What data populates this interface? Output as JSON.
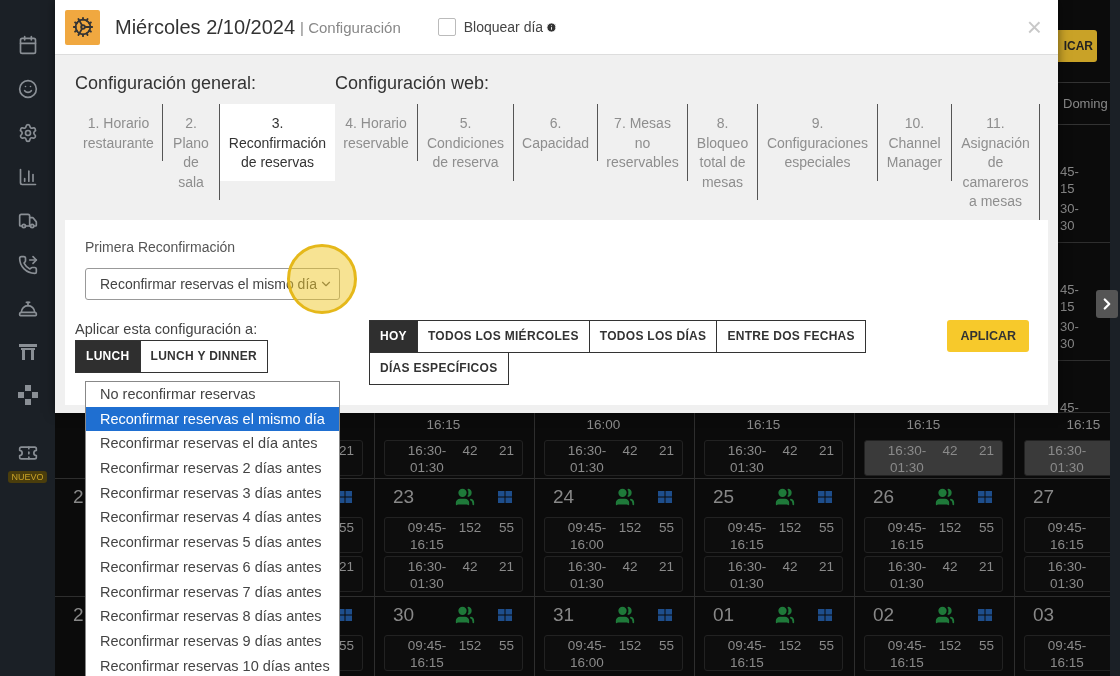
{
  "sidebar": {
    "badge": "NUEVO"
  },
  "topbar": {
    "apply_button": "ICAR",
    "day_header": "Doming"
  },
  "edge_rows": [
    {
      "lines": [
        "45-",
        "15",
        "30-",
        "30"
      ]
    },
    {
      "lines": [
        "45-",
        "15",
        "30-",
        "30"
      ]
    },
    {
      "lines": [
        "45-"
      ]
    }
  ],
  "calendar": {
    "weeks": [
      {
        "kind": "tail",
        "cells": [
          {
            "kind": "left"
          },
          {
            "kind": "right",
            "slots": [
              {
                "tables": "21"
              }
            ]
          },
          {
            "kind": "full",
            "slots": [
              {
                "time": [
                  "16:15"
                ]
              },
              {
                "time": [
                  "16:30-",
                  "01:30"
                ],
                "people": "42",
                "tables": "21",
                "highlighted": false
              }
            ]
          },
          {
            "kind": "full",
            "slots": [
              {
                "time": [
                  "16:00"
                ]
              },
              {
                "time": [
                  "16:30-",
                  "01:30"
                ],
                "people": "42",
                "tables": "21",
                "highlighted": false
              }
            ]
          },
          {
            "kind": "full",
            "slots": [
              {
                "time": [
                  "16:15"
                ]
              },
              {
                "time": [
                  "16:30-",
                  "01:30"
                ],
                "people": "42",
                "tables": "21",
                "highlighted": false
              }
            ]
          },
          {
            "kind": "full",
            "slots": [
              {
                "time": [
                  "16:15"
                ]
              },
              {
                "time": [
                  "16:30-",
                  "01:30"
                ],
                "people": "42",
                "tables": "21",
                "highlighted": true
              }
            ]
          },
          {
            "kind": "cut",
            "slots": [
              {
                "time": [
                  "16:15"
                ]
              },
              {
                "time": [
                  "16:30-",
                  "01:30"
                ],
                "highlighted": true
              }
            ]
          }
        ]
      },
      {
        "kind": "week",
        "cells": [
          {
            "kind": "left",
            "date": "2"
          },
          {
            "kind": "right",
            "slots": [
              {
                "tables": "55"
              },
              {
                "tables": "21"
              }
            ]
          },
          {
            "kind": "full",
            "date": "23",
            "slots": [
              {
                "time": [
                  "09:45-",
                  "16:15"
                ],
                "people": "152",
                "tables": "55",
                "highlighted": false
              },
              {
                "time": [
                  "16:30-",
                  "01:30"
                ],
                "people": "42",
                "tables": "21",
                "highlighted": false
              }
            ]
          },
          {
            "kind": "full",
            "date": "24",
            "slots": [
              {
                "time": [
                  "09:45-",
                  "16:00"
                ],
                "people": "152",
                "tables": "55",
                "highlighted": false
              },
              {
                "time": [
                  "16:30-",
                  "01:30"
                ],
                "people": "42",
                "tables": "21",
                "highlighted": false
              }
            ]
          },
          {
            "kind": "full",
            "date": "25",
            "slots": [
              {
                "time": [
                  "09:45-",
                  "16:15"
                ],
                "people": "152",
                "tables": "55",
                "highlighted": false
              },
              {
                "time": [
                  "16:30-",
                  "01:30"
                ],
                "people": "42",
                "tables": "21",
                "highlighted": false
              }
            ]
          },
          {
            "kind": "full",
            "date": "26",
            "slots": [
              {
                "time": [
                  "09:45-",
                  "16:15"
                ],
                "people": "152",
                "tables": "55",
                "highlighted": false
              },
              {
                "time": [
                  "16:30-",
                  "01:30"
                ],
                "people": "42",
                "tables": "21",
                "highlighted": false
              }
            ]
          },
          {
            "kind": "cut",
            "date": "27",
            "slots": [
              {
                "time": [
                  "09:45-",
                  "16:15"
                ],
                "highlighted": false
              },
              {
                "time": [
                  "16:30-",
                  "01:30"
                ],
                "highlighted": false
              }
            ]
          }
        ]
      },
      {
        "kind": "week",
        "cells": [
          {
            "kind": "left",
            "date": "2"
          },
          {
            "kind": "right",
            "slots": [
              {
                "tables": "55"
              }
            ]
          },
          {
            "kind": "full",
            "date": "30",
            "slots": [
              {
                "time": [
                  "09:45-",
                  "16:15"
                ],
                "people": "152",
                "tables": "55",
                "highlighted": false
              }
            ]
          },
          {
            "kind": "full",
            "date": "31",
            "slots": [
              {
                "time": [
                  "09:45-",
                  "16:00"
                ],
                "people": "152",
                "tables": "55",
                "highlighted": false
              }
            ]
          },
          {
            "kind": "full",
            "date": "01",
            "slots": [
              {
                "time": [
                  "09:45-",
                  "16:15"
                ],
                "people": "152",
                "tables": "55",
                "highlighted": false
              }
            ]
          },
          {
            "kind": "full",
            "date": "02",
            "slots": [
              {
                "time": [
                  "09:45-",
                  "16:15"
                ],
                "people": "152",
                "tables": "55",
                "highlighted": false
              }
            ]
          },
          {
            "kind": "cut",
            "date": "03",
            "slots": [
              {
                "time": [
                  "09:45-",
                  "16:15"
                ],
                "highlighted": false
              }
            ]
          }
        ]
      }
    ]
  },
  "modal": {
    "title": "Miércoles 2/10/2024",
    "subtitle": "| Configuración",
    "block_day": {
      "label": "Bloquear día",
      "checked": false
    },
    "close": "×",
    "groups": [
      {
        "heading": "Configuración general:",
        "tabs": [
          {
            "label": "1. Horario restaurante",
            "selected": false
          },
          {
            "label": "2. Plano de sala",
            "selected": false
          },
          {
            "label": "3. Reconfirmación de reservas",
            "selected": true
          }
        ]
      },
      {
        "heading": "Configuración web:",
        "tabs": [
          {
            "label": "4. Horario reservable",
            "selected": false
          },
          {
            "label": "5. Condiciones de reserva",
            "selected": false
          },
          {
            "label": "6. Capacidad",
            "selected": false
          },
          {
            "label": "7. Mesas no reservables",
            "selected": false
          },
          {
            "label": "8. Bloqueo total de mesas",
            "selected": false
          },
          {
            "label": "9. Configuraciones especiales",
            "selected": false
          },
          {
            "label": "10. Channel Manager",
            "selected": false
          },
          {
            "label": "11. Asignación de camareros a mesas",
            "selected": false
          }
        ]
      }
    ],
    "field_label": "Primera Reconfirmación",
    "select_value": "Reconfirmar reservas el mismo día",
    "apply_label": "Aplicar esta configuración a:",
    "services": [
      {
        "label": "LUNCH",
        "selected": true
      },
      {
        "label": "LUNCH Y DINNER",
        "selected": false
      }
    ],
    "ranges": [
      {
        "label": "HOY",
        "selected": true
      },
      {
        "label": "TODOS LOS MIÉRCOLES",
        "selected": false
      },
      {
        "label": "TODOS LOS DÍAS",
        "selected": false
      },
      {
        "label": "ENTRE DOS FECHAS",
        "selected": false
      },
      {
        "label": "DÍAS ESPECÍFICOS",
        "selected": false
      }
    ],
    "apply_button": "APLICAR"
  },
  "options": [
    {
      "label": "No reconfirmar reservas",
      "selected": false
    },
    {
      "label": "Reconfirmar reservas el mismo día",
      "selected": true
    },
    {
      "label": "Reconfirmar reservas el día antes",
      "selected": false
    },
    {
      "label": "Reconfirmar reservas 2 días antes",
      "selected": false
    },
    {
      "label": "Reconfirmar reservas 3 días antes",
      "selected": false
    },
    {
      "label": "Reconfirmar reservas 4 días antes",
      "selected": false
    },
    {
      "label": "Reconfirmar reservas 5 días antes",
      "selected": false
    },
    {
      "label": "Reconfirmar reservas 6 días antes",
      "selected": false
    },
    {
      "label": "Reconfirmar reservas 7 días antes",
      "selected": false
    },
    {
      "label": "Reconfirmar reservas 8 días antes",
      "selected": false
    },
    {
      "label": "Reconfirmar reservas 9 días antes",
      "selected": false
    },
    {
      "label": "Reconfirmar reservas 10 días antes",
      "selected": false
    }
  ]
}
